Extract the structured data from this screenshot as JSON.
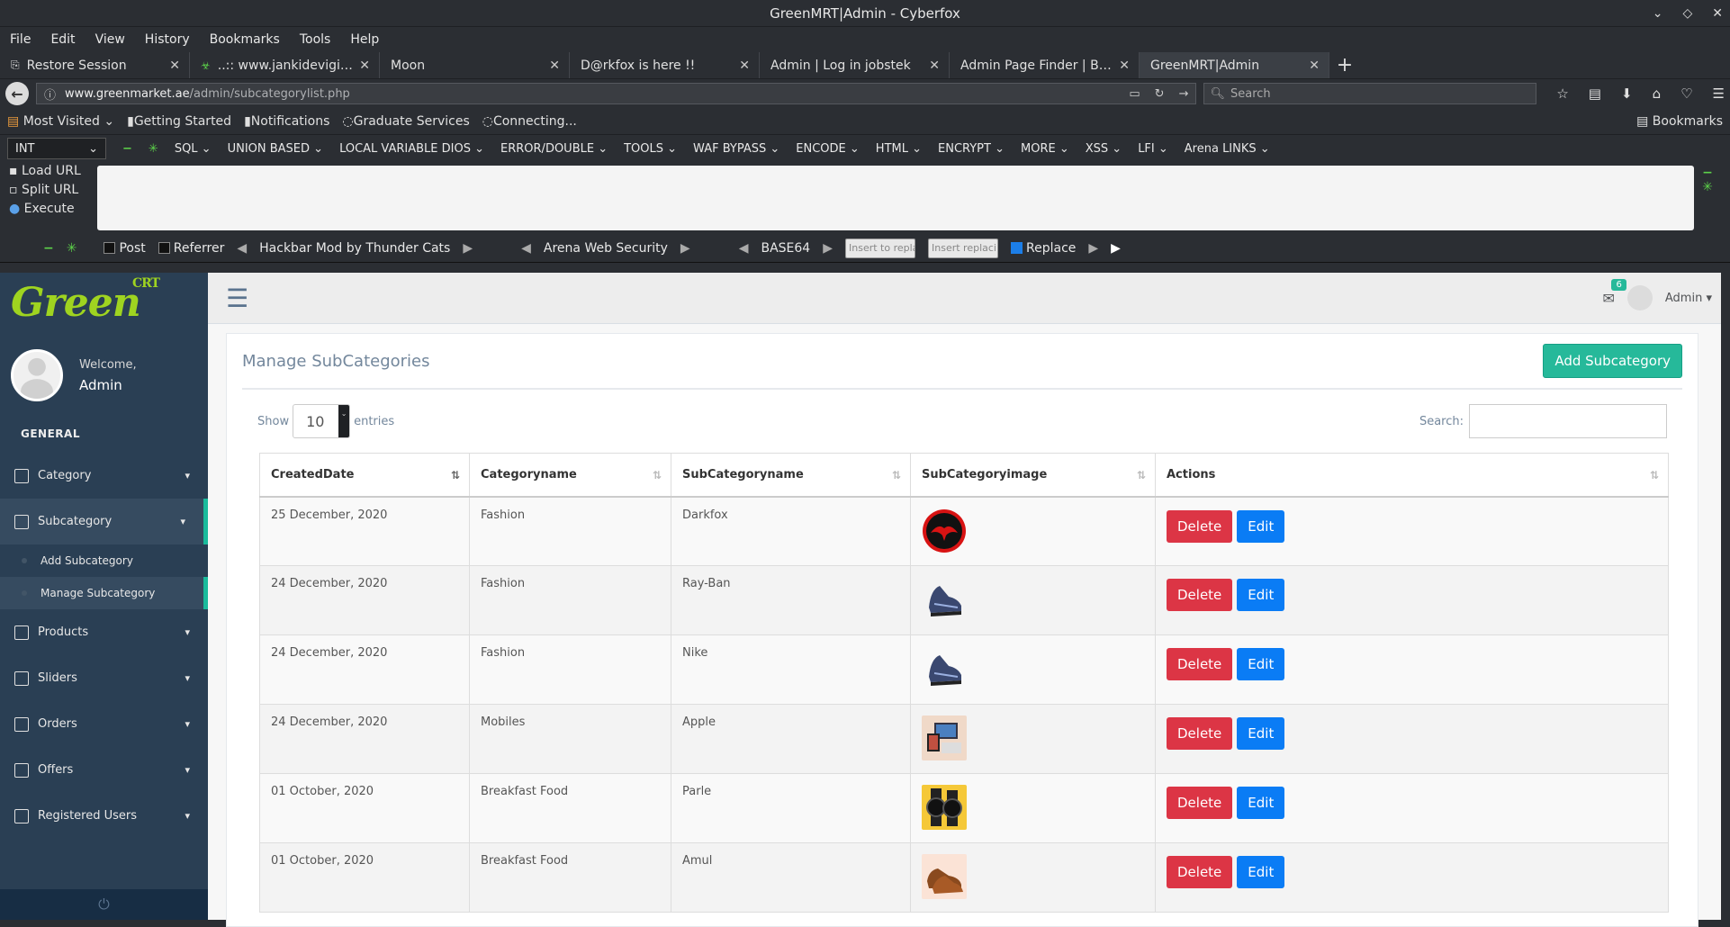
{
  "window": {
    "title": "GreenMRT|Admin - Cyberfox",
    "controls": [
      "⌄",
      "◇",
      "✕"
    ]
  },
  "menu": [
    "File",
    "Edit",
    "View",
    "History",
    "Bookmarks",
    "Tools",
    "Help"
  ],
  "tabs": [
    {
      "label": "Restore Session",
      "icon": "restore-icon",
      "active": false
    },
    {
      "label": "..:: www.jankidevigirlsc...",
      "icon": "biohazard-icon",
      "active": false
    },
    {
      "label": "Moon",
      "icon": "",
      "active": false
    },
    {
      "label": "D@rkfox is here !!",
      "icon": "",
      "active": false
    },
    {
      "label": "Admin | Log in jobstek",
      "icon": "",
      "active": false
    },
    {
      "label": "Admin Page Finder | By: S...",
      "icon": "",
      "active": false
    },
    {
      "label": "GreenMRT|Admin",
      "icon": "",
      "active": true
    }
  ],
  "url": {
    "domain": "www.greenmarket.ae",
    "path": "/admin/subcategorylist.php"
  },
  "search_placeholder": "Search",
  "bookmarks": [
    "Most Visited",
    "Getting Started",
    "Notifications",
    "Graduate Services",
    "Connecting..."
  ],
  "bookmarks_right": "Bookmarks",
  "hackbar": {
    "select": "INT",
    "menus": [
      "SQL",
      "UNION BASED",
      "LOCAL VARIABLE DIOS",
      "ERROR/DOUBLE",
      "TOOLS",
      "WAF BYPASS",
      "ENCODE",
      "HTML",
      "ENCRYPT",
      "MORE",
      "XSS",
      "LFI",
      "Arena LINKS"
    ],
    "actions": [
      "Load URL",
      "Split URL",
      "Execute"
    ],
    "post": "Post",
    "referrer": "Referrer",
    "title1": "Hackbar Mod by Thunder Cats",
    "title2": "Arena Web Security",
    "title3": "BASE64",
    "insert1": "Insert to replac",
    "insert2": "Insert replacing",
    "replace": "Replace"
  },
  "sidebar": {
    "welcome": "Welcome,",
    "name": "Admin",
    "section": "GENERAL",
    "items": [
      {
        "label": "Category"
      },
      {
        "label": "Subcategory"
      },
      {
        "label": "Products"
      },
      {
        "label": "Sliders"
      },
      {
        "label": "Orders"
      },
      {
        "label": "Offers"
      },
      {
        "label": "Registered Users"
      }
    ],
    "sub": [
      "Add Subcategory",
      "Manage Subcategory"
    ],
    "logo": "Green",
    "logo_sup": "CRT"
  },
  "topnav": {
    "badge": "6",
    "user": "Admin"
  },
  "panel": {
    "title": "Manage SubCategories",
    "add_button": "Add Subcategory",
    "show": "Show",
    "entries_value": "10",
    "entries": "entries",
    "search": "Search:"
  },
  "table": {
    "headers": [
      "CreatedDate",
      "Categoryname",
      "SubCategoryname",
      "SubCategoryimage",
      "Actions"
    ],
    "rows": [
      {
        "date": "25 December, 2020",
        "category": "Fashion",
        "sub": "Darkfox",
        "img": "thundercats-logo"
      },
      {
        "date": "24 December, 2020",
        "category": "Fashion",
        "sub": "Ray-Ban",
        "img": "shoe"
      },
      {
        "date": "24 December, 2020",
        "category": "Fashion",
        "sub": "Nike",
        "img": "shoe"
      },
      {
        "date": "24 December, 2020",
        "category": "Mobiles",
        "sub": "Apple",
        "img": "devices"
      },
      {
        "date": "01 October, 2020",
        "category": "Breakfast Food",
        "sub": "Parle",
        "img": "watch"
      },
      {
        "date": "01 October, 2020",
        "category": "Breakfast Food",
        "sub": "Amul",
        "img": "leather-shoe"
      }
    ],
    "delete": "Delete",
    "edit": "Edit"
  }
}
